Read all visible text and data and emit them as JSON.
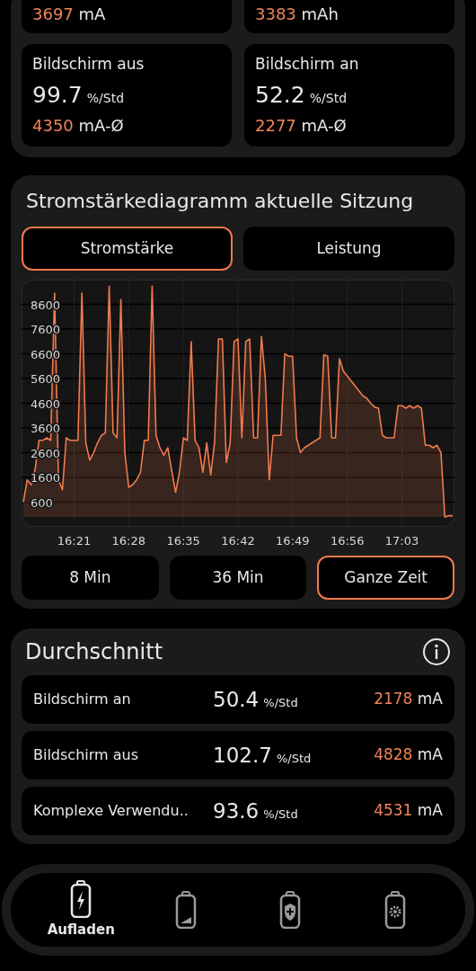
{
  "top_cards": [
    {
      "value": "3697",
      "unit": "mA"
    },
    {
      "value": "3383",
      "unit": "mAh"
    }
  ],
  "stat_cards": [
    {
      "label": "Bildschirm aus",
      "rate": "99.7",
      "rate_unit": "%/Std",
      "current": "4350",
      "current_unit": "mA-Ø"
    },
    {
      "label": "Bildschirm an",
      "rate": "52.2",
      "rate_unit": "%/Std",
      "current": "2277",
      "current_unit": "mA-Ø"
    }
  ],
  "chart_section": {
    "title": "Stromstärkediagramm aktuelle Sitzung",
    "tabs": [
      {
        "label": "Stromstärke",
        "selected": true
      },
      {
        "label": "Leistung",
        "selected": false
      }
    ],
    "chart_data": {
      "type": "area",
      "grid": true,
      "ylim": [
        -400,
        9600
      ],
      "categories": [
        null,
        null,
        null,
        null,
        null,
        null,
        null,
        null,
        null,
        null,
        null,
        null,
        null,
        "16:21",
        null,
        null,
        null,
        null,
        null,
        null,
        null,
        null,
        null,
        null,
        null,
        null,
        null,
        "16:28",
        null,
        null,
        null,
        null,
        null,
        null,
        null,
        null,
        null,
        null,
        null,
        null,
        null,
        "16:35",
        null,
        null,
        null,
        null,
        null,
        null,
        null,
        null,
        null,
        null,
        null,
        null,
        null,
        "16:42",
        null,
        null,
        null,
        null,
        null,
        null,
        null,
        null,
        null,
        null,
        null,
        null,
        null,
        "16:49",
        null,
        null,
        null,
        null,
        null,
        null,
        null,
        null,
        null,
        null,
        null,
        null,
        null,
        "16:56",
        null,
        null,
        null,
        null,
        null,
        null,
        null,
        null,
        null,
        null,
        null,
        null,
        null,
        "17:03",
        null,
        null,
        null,
        null,
        null,
        null,
        null,
        null,
        null,
        null,
        null,
        null,
        null
      ],
      "yticks": [
        600,
        1600,
        2600,
        3600,
        4600,
        5600,
        6600,
        7600,
        8600
      ],
      "series": [
        {
          "color": "#f07a4e",
          "values": [
            600,
            1500,
            1300,
            1900,
            3100,
            3100,
            3200,
            3100,
            9050,
            1500,
            1100,
            3200,
            3100,
            3100,
            3100,
            9050,
            3000,
            2300,
            2600,
            3000,
            3300,
            3400,
            9340,
            3400,
            3200,
            8800,
            2600,
            1200,
            1300,
            1500,
            1800,
            3100,
            3100,
            9340,
            3300,
            2800,
            2500,
            2800,
            1900,
            1000,
            1800,
            3200,
            3100,
            7090,
            3100,
            2800,
            1800,
            3000,
            1700,
            3000,
            7200,
            7200,
            2200,
            3000,
            7100,
            7200,
            3200,
            7100,
            7200,
            3200,
            3200,
            7300,
            5600,
            1500,
            3300,
            3300,
            3300,
            6600,
            6500,
            6500,
            3200,
            2600,
            2800,
            2900,
            3000,
            3100,
            3200,
            6560,
            6500,
            3200,
            3200,
            6400,
            5900,
            5700,
            5500,
            5300,
            5100,
            4900,
            4800,
            4600,
            4440,
            4400,
            3300,
            3200,
            3200,
            3200,
            4500,
            4500,
            4400,
            4500,
            4400,
            4500,
            4400,
            2900,
            2900,
            2800,
            2900,
            2600,
            0,
            50,
            50
          ]
        }
      ]
    },
    "ranges": [
      {
        "label": "8 Min",
        "selected": false
      },
      {
        "label": "36 Min",
        "selected": false
      },
      {
        "label": "Ganze Zeit",
        "selected": true
      }
    ]
  },
  "average": {
    "title": "Durchschnitt",
    "rows": [
      {
        "label": "Bildschirm an",
        "rate": "50.4",
        "rate_unit": "%/Std",
        "current": "2178",
        "current_unit": "mA"
      },
      {
        "label": "Bildschirm aus",
        "rate": "102.7",
        "rate_unit": "%/Std",
        "current": "4828",
        "current_unit": "mA"
      },
      {
        "label": "Komplexe Verwendu..",
        "rate": "93.6",
        "rate_unit": "%/Std",
        "current": "4531",
        "current_unit": "mA"
      }
    ]
  },
  "bottom_nav": [
    {
      "kind": "charge",
      "label": "Aufladen",
      "selected": true
    },
    {
      "kind": "level",
      "selected": false
    },
    {
      "kind": "shield",
      "selected": false
    },
    {
      "kind": "gear",
      "selected": false
    }
  ]
}
